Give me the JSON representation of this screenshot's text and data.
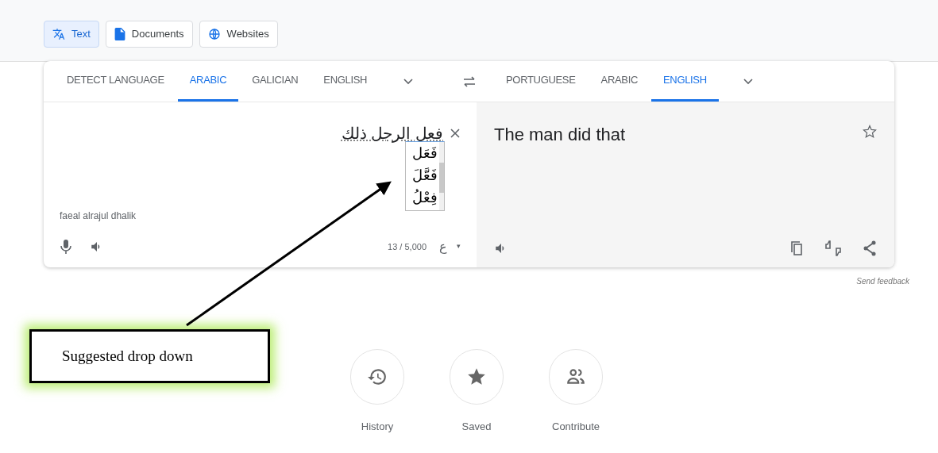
{
  "mode_buttons": [
    {
      "label": "Text",
      "selected": true
    },
    {
      "label": "Documents",
      "selected": false
    },
    {
      "label": "Websites",
      "selected": false
    }
  ],
  "source_languages": [
    {
      "label": "DETECT LANGUAGE",
      "selected": false
    },
    {
      "label": "ARABIC",
      "selected": true
    },
    {
      "label": "GALICIAN",
      "selected": false
    },
    {
      "label": "ENGLISH",
      "selected": false
    }
  ],
  "target_languages": [
    {
      "label": "PORTUGUESE",
      "selected": false
    },
    {
      "label": "ARABIC",
      "selected": false
    },
    {
      "label": "ENGLISH",
      "selected": true
    }
  ],
  "source": {
    "text": "فعل الرجل ذلك",
    "transliteration": "faeal alrajul dhalik",
    "char_count": "13 / 5,000",
    "keyboard": "ع",
    "keyboard_caret": "▾"
  },
  "suggestions": [
    "فَعَل",
    "فَعَّلَ",
    "فِعْلُ"
  ],
  "translation": {
    "text": "The man did that"
  },
  "send_feedback": "Send feedback",
  "annotation": {
    "text": "Suggested drop down"
  },
  "shortcuts": [
    {
      "label": "History"
    },
    {
      "label": "Saved"
    },
    {
      "label": "Contribute"
    }
  ]
}
